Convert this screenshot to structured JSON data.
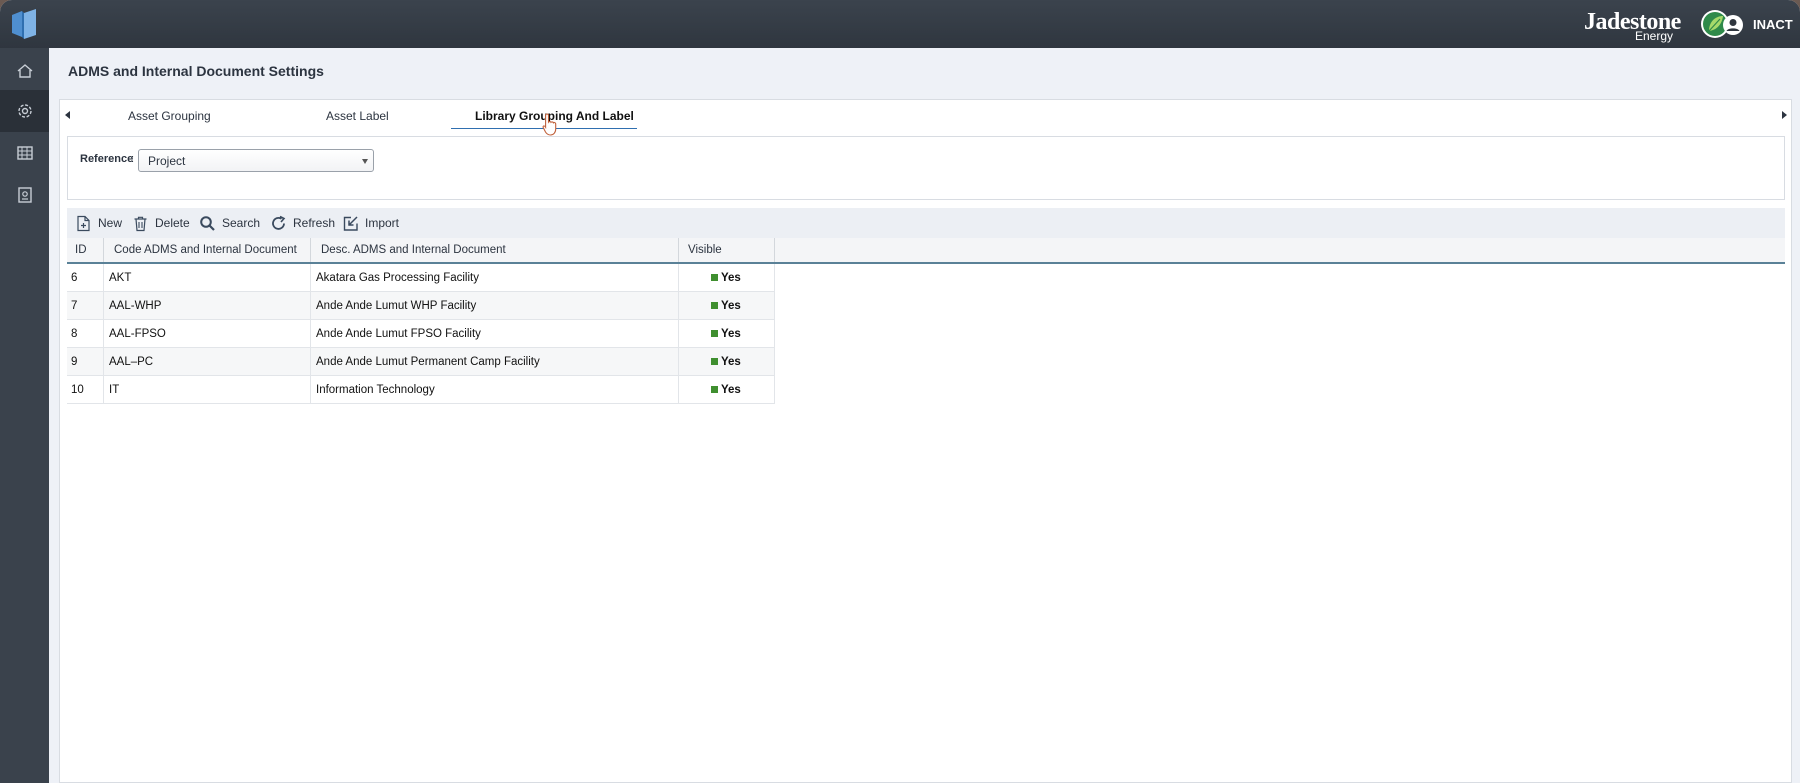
{
  "header": {
    "brand_name": "Jadestone",
    "brand_sub": "Energy",
    "user": "INACT"
  },
  "page": {
    "title": "ADMS and Internal Document Settings"
  },
  "tabs": [
    {
      "label": "Asset Grouping"
    },
    {
      "label": "Asset Label"
    },
    {
      "label": "Library Grouping And Label",
      "active": true
    }
  ],
  "reference": {
    "label": "Reference",
    "colon": ":",
    "value": "Project"
  },
  "toolbar": {
    "new_label": "New",
    "delete_label": "Delete",
    "search_label": "Search",
    "refresh_label": "Refresh",
    "import_label": "Import"
  },
  "table": {
    "columns": [
      "ID",
      "Code ADMS and Internal Document",
      "Desc. ADMS and Internal Document",
      "Visible"
    ],
    "rows": [
      {
        "id": "6",
        "code": "AKT",
        "desc": "Akatara Gas Processing Facility",
        "visible": "Yes"
      },
      {
        "id": "7",
        "code": "AAL-WHP",
        "desc": "Ande Ande Lumut WHP Facility",
        "visible": "Yes"
      },
      {
        "id": "8",
        "code": "AAL-FPSO",
        "desc": "Ande Ande Lumut FPSO Facility",
        "visible": "Yes"
      },
      {
        "id": "9",
        "code": "AAL–PC",
        "desc": "Ande Ande Lumut Permanent Camp Facility",
        "visible": "Yes"
      },
      {
        "id": "10",
        "code": "IT",
        "desc": "Information Technology",
        "visible": "Yes"
      }
    ]
  },
  "colors": {
    "topbar": "#2f363f",
    "sidebar": "#3a424c",
    "accent": "#2f6fb0",
    "visible_yes": "#3f8f2f"
  },
  "icons": {
    "sidebar": [
      "home-icon",
      "gear-icon",
      "grid-icon",
      "document-icon"
    ],
    "toolbar": [
      "file-plus-icon",
      "trash-icon",
      "search-icon",
      "refresh-icon",
      "import-icon"
    ]
  }
}
